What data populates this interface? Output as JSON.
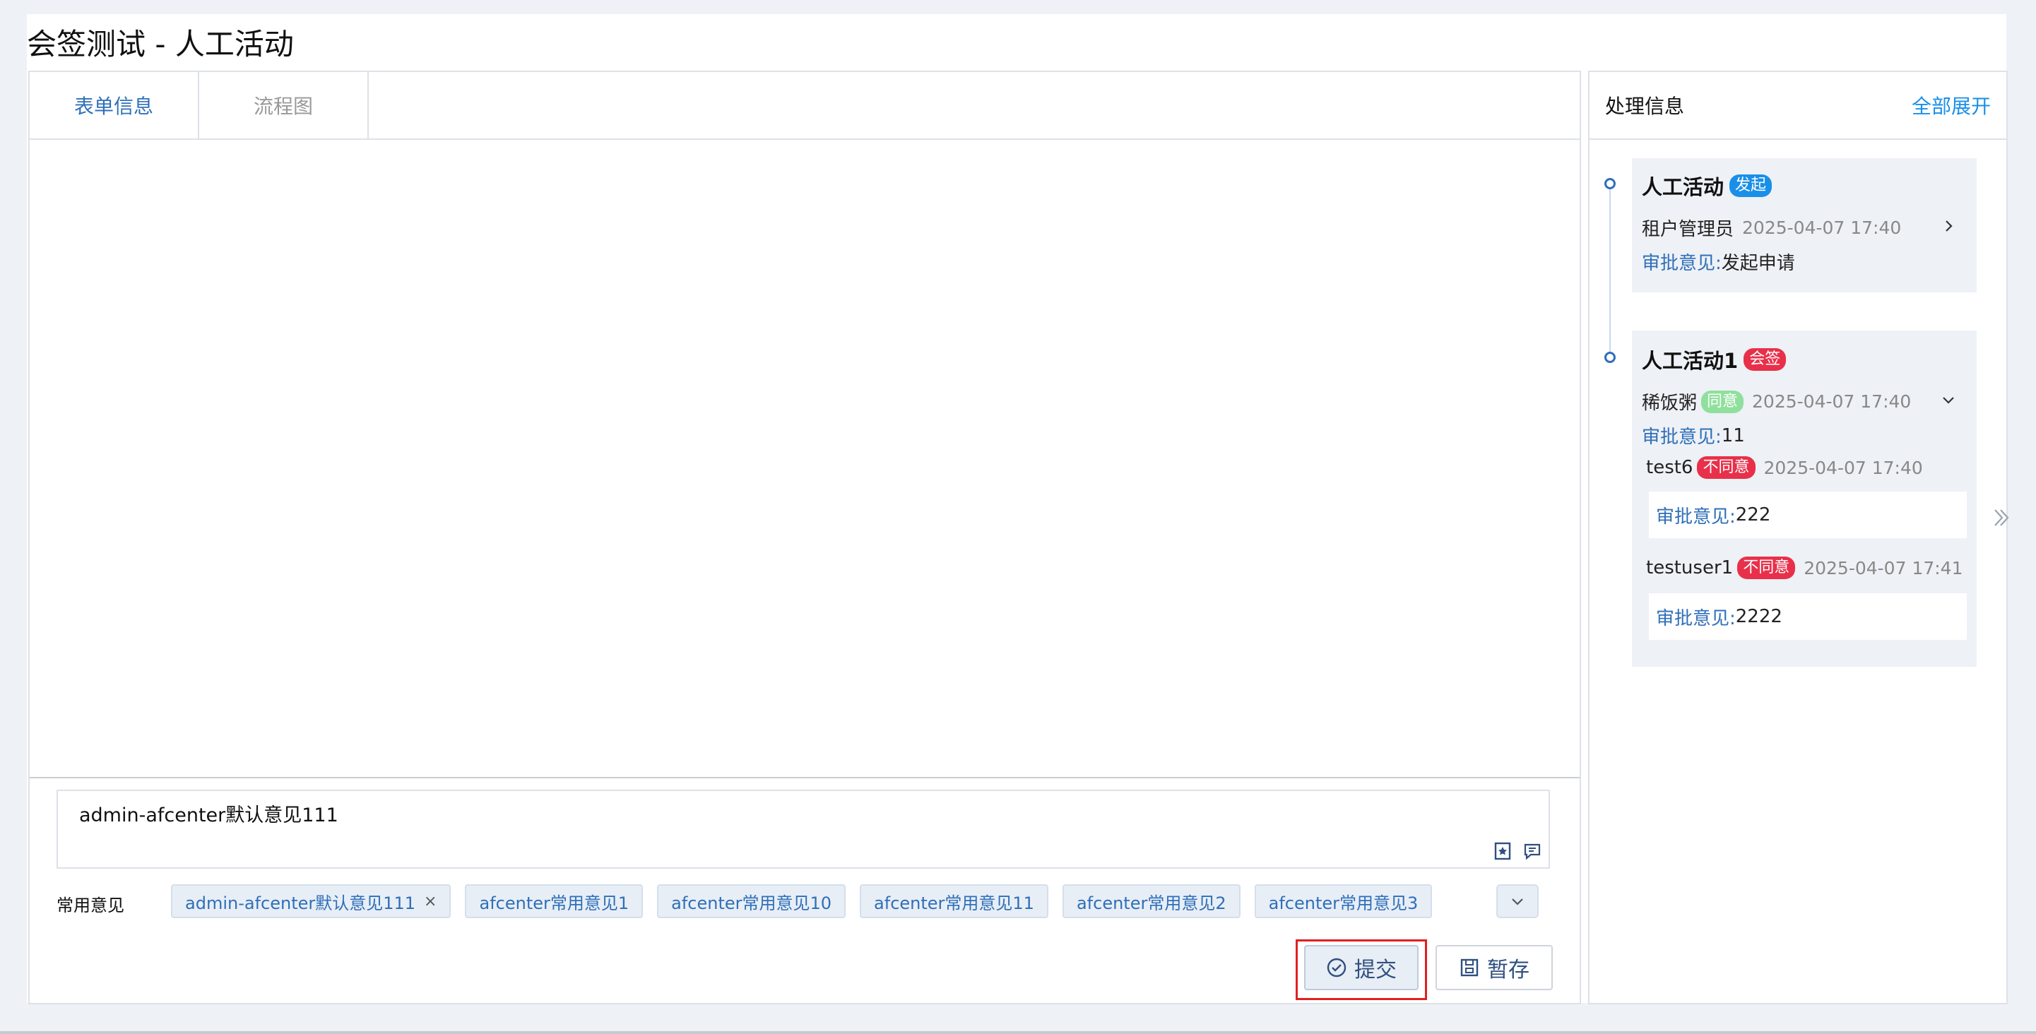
{
  "page": {
    "title": "会签测试 - 人工活动"
  },
  "tabs": [
    {
      "label": "表单信息",
      "active": true
    },
    {
      "label": "流程图",
      "active": false
    }
  ],
  "comment": {
    "value": "admin-afcenter默认意见111"
  },
  "common": {
    "label": "常用意见",
    "chips": [
      "admin-afcenter默认意见111",
      "afcenter常用意见1",
      "afcenter常用意见10",
      "afcenter常用意见11",
      "afcenter常用意见2",
      "afcenter常用意见3"
    ],
    "remove_symbol": "×"
  },
  "actions": {
    "submit_label": "提交",
    "save_label": "暂存"
  },
  "side": {
    "title": "处理信息",
    "expand_all": "全部展开",
    "opinion_label": "审批意见:",
    "nodes": [
      {
        "name": "人工活动",
        "badge": "发起",
        "user": "租户管理员",
        "time": "2025-04-07 17:40",
        "opinion": "发起申请"
      },
      {
        "name": "人工活动1",
        "badge": "会签",
        "user": "稀饭粥",
        "status": "同意",
        "time": "2025-04-07 17:40",
        "opinion": "11",
        "subs": [
          {
            "user": "test6",
            "status": "不同意",
            "time": "2025-04-07 17:40",
            "opinion": "222"
          },
          {
            "user": "testuser1",
            "status": "不同意",
            "time": "2025-04-07 17:41",
            "opinion": "2222"
          }
        ]
      }
    ]
  },
  "colors": {
    "accent": "#2f6fb8",
    "link": "#1a8fe8",
    "danger": "#e8304a",
    "agree": "#8fe09c",
    "highlight": "#e02020"
  },
  "icons": [
    "bookmark-star-icon",
    "comment-icon",
    "chevron-down-icon",
    "check-circle-icon",
    "save-icon",
    "chevron-right-icon",
    "double-chevron-right-icon"
  ]
}
